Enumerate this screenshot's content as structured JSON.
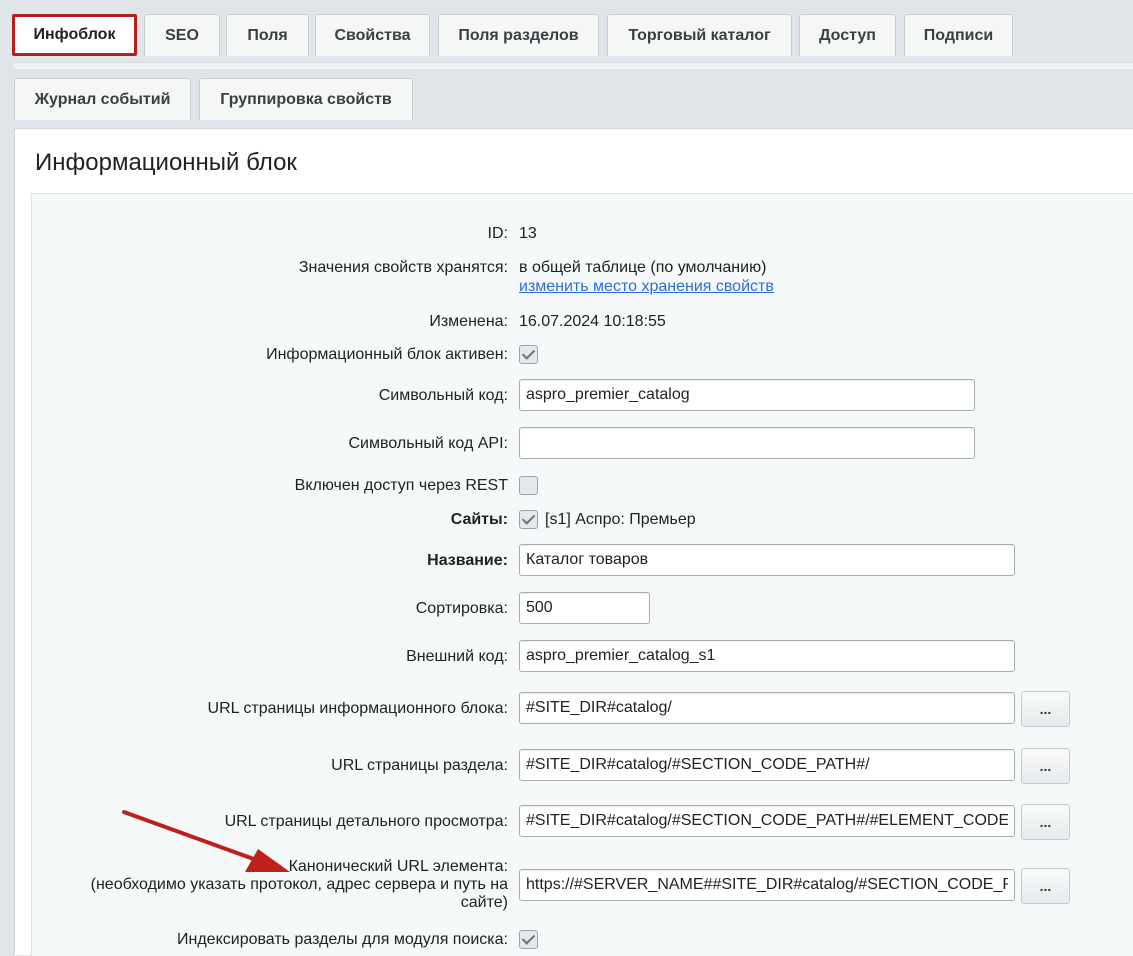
{
  "tabs_row1": [
    {
      "label": "Инфоблок",
      "active": true
    },
    {
      "label": "SEO"
    },
    {
      "label": "Поля"
    },
    {
      "label": "Свойства"
    },
    {
      "label": "Поля разделов"
    },
    {
      "label": "Торговый каталог"
    },
    {
      "label": "Доступ"
    },
    {
      "label": "Подписи"
    }
  ],
  "tabs_row2": [
    {
      "label": "Журнал событий"
    },
    {
      "label": "Группировка свойств"
    }
  ],
  "panel": {
    "title": "Информационный блок"
  },
  "form": {
    "id_label": "ID:",
    "id_value": "13",
    "storage_label": "Значения свойств хранятся:",
    "storage_value": "в общей таблице (по умолчанию)",
    "storage_link": "изменить место хранения свойств",
    "modified_label": "Изменена:",
    "modified_value": "16.07.2024 10:18:55",
    "active_label": "Информационный блок активен:",
    "active_checked": true,
    "code_label": "Символьный код:",
    "code_value": "aspro_premier_catalog",
    "api_code_label": "Символьный код API:",
    "api_code_value": "",
    "rest_label": "Включен доступ через REST",
    "rest_checked": false,
    "sites_label": "Сайты:",
    "sites_value": "[s1] Аспро: Премьер",
    "sites_checked": true,
    "name_label": "Название:",
    "name_value": "Каталог товаров",
    "sort_label": "Сортировка:",
    "sort_value": "500",
    "xml_label": "Внешний код:",
    "xml_value": "aspro_premier_catalog_s1",
    "list_url_label": "URL страницы информационного блока:",
    "list_url_value": "#SITE_DIR#catalog/",
    "section_url_label": "URL страницы раздела:",
    "section_url_value": "#SITE_DIR#catalog/#SECTION_CODE_PATH#/",
    "detail_url_label": "URL страницы детального просмотра:",
    "detail_url_value": "#SITE_DIR#catalog/#SECTION_CODE_PATH#/#ELEMENT_CODE#/",
    "canonical_label_1": "Канонический URL элемента:",
    "canonical_label_2": "(необходимо указать протокол, адрес сервера и путь на",
    "canonical_label_3": "сайте)",
    "canonical_value": "https://#SERVER_NAME##SITE_DIR#catalog/#SECTION_CODE_PATH#/#ELEMENT_CODE#/",
    "index_label": "Индексировать разделы для модуля поиска:",
    "index_checked": true,
    "dots_label": "..."
  },
  "colors": {
    "active_tab_border": "#b5201f",
    "link": "#2a6fd8",
    "arrow": "#c0201c"
  }
}
